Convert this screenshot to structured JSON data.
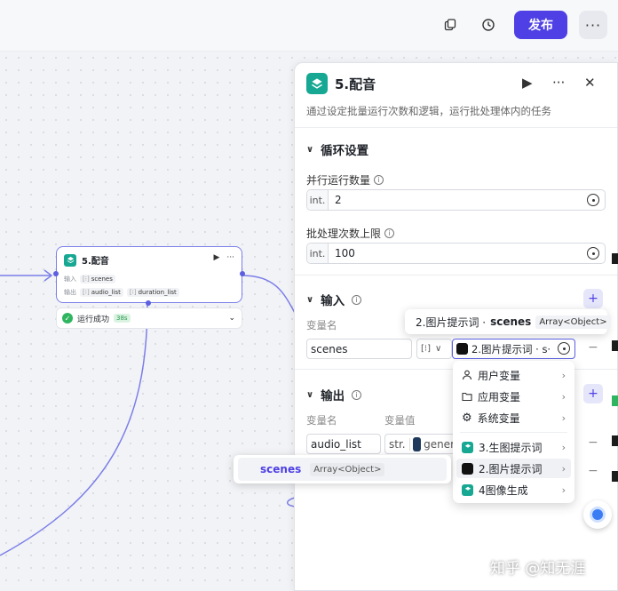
{
  "header": {
    "publish_label": "发布",
    "more_label": "···"
  },
  "node": {
    "title": "5.配音",
    "input_label": "输入",
    "input_tag": "scenes",
    "output_label": "输出",
    "output_tags": [
      "audio_list",
      "duration_list"
    ],
    "status_text": "运行成功",
    "status_time": "38s"
  },
  "panel": {
    "title": "5.配音",
    "description": "通过设定批量运行次数和逻辑，运行批处理体内的任务",
    "loop_section": "循环设置",
    "parallel_label": "并行运行数量",
    "parallel_prefix": "int.",
    "parallel_value": "2",
    "limit_label": "批处理次数上限",
    "limit_prefix": "int.",
    "limit_value": "100",
    "input_section": "输入",
    "var_name_header": "变量名",
    "input_var": "scenes",
    "input_type": "[⁝]",
    "input_ref": "2.图片提示词 · s·",
    "output_section": "输出",
    "var_value_header": "变量值",
    "output_var": "audio_list",
    "output_type": "str.",
    "output_ref": "gener"
  },
  "tooltip": {
    "source": "2.图片提示词 ·",
    "var": "scenes",
    "type": "Array<Object>"
  },
  "menu": {
    "items": [
      {
        "label": "用户变量",
        "icon": "user-icon"
      },
      {
        "label": "应用变量",
        "icon": "folder-icon"
      },
      {
        "label": "系统变量",
        "icon": "gear-icon"
      },
      {
        "label": "3.生图提示词",
        "icon": "stack-icon"
      },
      {
        "label": "2.图片提示词",
        "icon": "gpt-icon"
      },
      {
        "label": "4图像生成",
        "icon": "stack-icon"
      }
    ]
  },
  "submenu": {
    "name": "scenes",
    "type": "Array<Object>"
  },
  "watermark": "知乎 @知无涯",
  "colors": {
    "accent": "#4e40e5",
    "teal": "#16a892",
    "success": "#2fb560"
  }
}
